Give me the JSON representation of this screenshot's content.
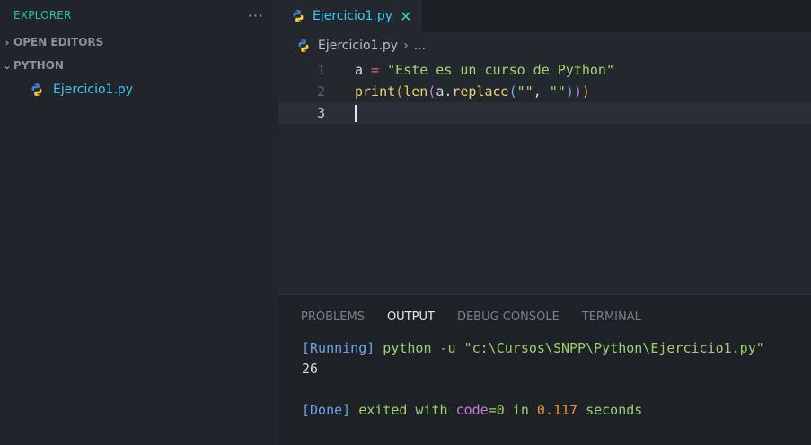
{
  "explorer": {
    "title": "EXPLORER",
    "more_label": "···",
    "sections": [
      {
        "label": "OPEN EDITORS",
        "chevron": "›"
      },
      {
        "label": "PYTHON",
        "chevron": "⌄"
      }
    ],
    "files": [
      {
        "name": "Ejercicio1.py",
        "icon": "python-icon"
      }
    ]
  },
  "editor": {
    "tab": {
      "label": "Ejercicio1.py",
      "close": "✕"
    },
    "breadcrumb": {
      "file": "Ejercicio1.py",
      "sep": "›",
      "more": "..."
    },
    "lines": [
      {
        "number": "1",
        "tokens": [
          {
            "text": "a",
            "color": "#d7dbe0"
          },
          {
            "text": " = ",
            "color": "#e0636f"
          },
          {
            "text": "\"Este es un curso de Python\"",
            "color": "#a7d374"
          }
        ]
      },
      {
        "number": "2",
        "tokens": [
          {
            "text": "print",
            "color": "#e6d36b"
          },
          {
            "text": "(",
            "color": "#e6b03c"
          },
          {
            "text": "len",
            "color": "#e6d36b"
          },
          {
            "text": "(",
            "color": "#c678dd"
          },
          {
            "text": "a",
            "color": "#d7dbe0"
          },
          {
            "text": ".",
            "color": "#d7dbe0"
          },
          {
            "text": "replace",
            "color": "#e6d36b"
          },
          {
            "text": "(",
            "color": "#56b6f2"
          },
          {
            "text": "\"\"",
            "color": "#a7d374"
          },
          {
            "text": ", ",
            "color": "#d7dbe0"
          },
          {
            "text": "\"\"",
            "color": "#a7d374"
          },
          {
            "text": ")",
            "color": "#56b6f2"
          },
          {
            "text": ")",
            "color": "#c678dd"
          },
          {
            "text": ")",
            "color": "#e6b03c"
          }
        ]
      },
      {
        "number": "3",
        "tokens": []
      }
    ]
  },
  "panel": {
    "tabs": [
      {
        "label": "PROBLEMS",
        "active": false
      },
      {
        "label": "OUTPUT",
        "active": true
      },
      {
        "label": "DEBUG CONSOLE",
        "active": false
      },
      {
        "label": "TERMINAL",
        "active": false
      }
    ],
    "output": {
      "running_tag": "[Running]",
      "command": " python -u \"c:\\Cursos\\SNPP\\Python\\Ejercicio1.py\"",
      "result": "26",
      "done_tag": "[Done]",
      "exited_with": " exited with ",
      "code_label": "code",
      "code_eq": "=0",
      "in_label": " in ",
      "time": "0.117",
      "seconds_label": " seconds"
    }
  }
}
